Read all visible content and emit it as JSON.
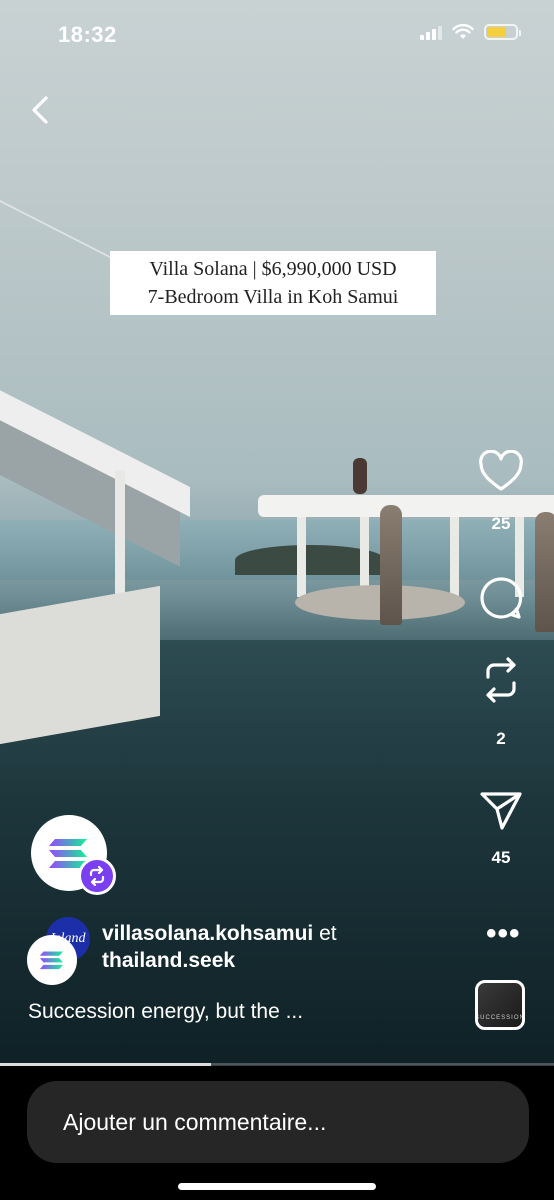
{
  "status_bar": {
    "time": "18:32",
    "battery_level": 0.7,
    "battery_color": "#f4d03f"
  },
  "video": {
    "title_line1": "Villa Solana | $6,990,000 USD",
    "title_line2": "7-Bedroom Villa in Koh Samui"
  },
  "actions": {
    "like_count": "25",
    "comment_count": "",
    "repost_count": "2",
    "share_count": "45",
    "more_icon": "ellipsis-icon"
  },
  "author": {
    "user1": "villasolana.kohsamui",
    "conjunction": " et",
    "user2": "thailand.seek",
    "avatar1_text": "Island"
  },
  "caption": "Succession energy, but the ...",
  "audio_label": "SUCCESSION",
  "progress": 0.38,
  "comment_placeholder": "Ajouter un commentaire...",
  "colors": {
    "repost_badge": "#7b3ff2",
    "comment_field": "#262626"
  }
}
